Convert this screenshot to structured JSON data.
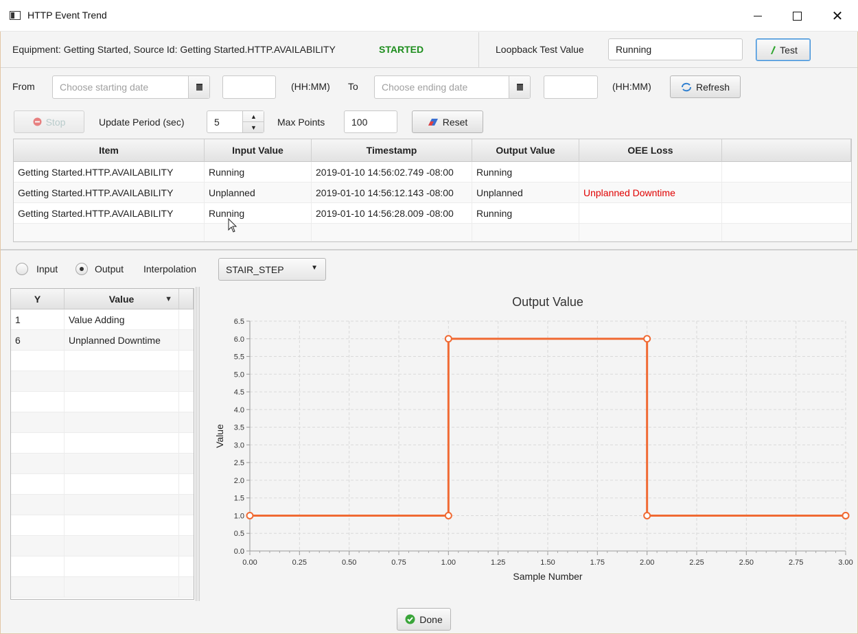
{
  "window": {
    "title": "HTTP Event Trend"
  },
  "header": {
    "equipment_text": "Equipment: Getting Started, Source Id: Getting Started.HTTP.AVAILABILITY",
    "status": "STARTED",
    "status_color": "#1c8d1c",
    "loopback_label": "Loopback Test Value",
    "loopback_value": "Running",
    "test_button": "Test"
  },
  "range": {
    "from_label": "From",
    "from_date_placeholder": "Choose starting date",
    "from_time": "",
    "time_hint": "(HH:MM)",
    "to_label": "To",
    "to_date_placeholder": "Choose ending date",
    "to_time": "",
    "refresh_button": "Refresh"
  },
  "controls": {
    "stop_button": "Stop",
    "update_period_label": "Update Period (sec)",
    "update_period_value": "5",
    "max_points_label": "Max Points",
    "max_points_value": "100",
    "reset_button": "Reset"
  },
  "events_table": {
    "columns": [
      "Item",
      "Input Value",
      "Timestamp",
      "Output Value",
      "OEE Loss"
    ],
    "rows": [
      [
        "Getting Started.HTTP.AVAILABILITY",
        "Running",
        "2019-01-10 14:56:02.749 -08:00",
        "Running",
        ""
      ],
      [
        "Getting Started.HTTP.AVAILABILITY",
        "Unplanned",
        "2019-01-10 14:56:12.143 -08:00",
        "Unplanned",
        "Unplanned Downtime"
      ],
      [
        "Getting Started.HTTP.AVAILABILITY",
        "Running",
        "2019-01-10 14:56:28.009 -08:00",
        "Running",
        ""
      ]
    ],
    "loss_color": "#e00000"
  },
  "chart_options": {
    "input_label": "Input",
    "output_label": "Output",
    "selected": "Output",
    "interpolation_label": "Interpolation",
    "interpolation_value": "STAIR_STEP"
  },
  "mapping_table": {
    "columns": [
      "Y",
      "Value"
    ],
    "rows": [
      [
        "1",
        "Value Adding"
      ],
      [
        "6",
        "Unplanned Downtime"
      ]
    ]
  },
  "chart_data": {
    "type": "line",
    "title": "Output Value",
    "xlabel": "Sample Number",
    "ylabel": "Value",
    "xlim": [
      0,
      3
    ],
    "ylim": [
      0,
      6.5
    ],
    "x_ticks": [
      "0.00",
      "0.25",
      "0.50",
      "0.75",
      "1.00",
      "1.25",
      "1.50",
      "1.75",
      "2.00",
      "2.25",
      "2.50",
      "2.75",
      "3.00"
    ],
    "y_ticks": [
      "0.0",
      "0.5",
      "1.0",
      "1.5",
      "2.0",
      "2.5",
      "3.0",
      "3.5",
      "4.0",
      "4.5",
      "5.0",
      "5.5",
      "6.0",
      "6.5"
    ],
    "grid": true,
    "series": [
      {
        "x": [
          0,
          1,
          2,
          3
        ],
        "y": [
          1,
          6,
          1,
          1
        ],
        "color": "#f06a33",
        "interpolation": "stair_step"
      }
    ]
  },
  "footer": {
    "done_button": "Done"
  }
}
